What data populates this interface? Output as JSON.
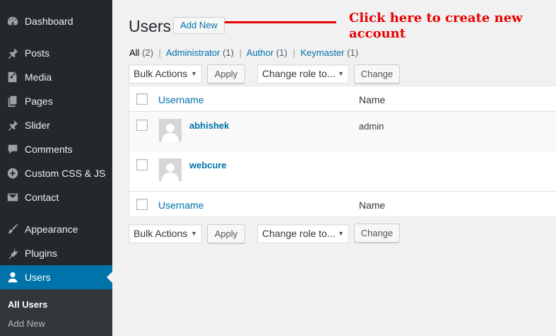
{
  "sidebar": {
    "items": [
      {
        "label": "Dashboard",
        "icon": "dashboard-icon"
      },
      {
        "label": "Posts",
        "icon": "pin-icon"
      },
      {
        "label": "Media",
        "icon": "media-icon"
      },
      {
        "label": "Pages",
        "icon": "pages-icon"
      },
      {
        "label": "Slider",
        "icon": "pin-icon"
      },
      {
        "label": "Comments",
        "icon": "comment-icon"
      },
      {
        "label": "Custom CSS & JS",
        "icon": "plus-circle-icon"
      },
      {
        "label": "Contact",
        "icon": "mail-icon"
      },
      {
        "label": "Appearance",
        "icon": "brush-icon"
      },
      {
        "label": "Plugins",
        "icon": "plugin-icon"
      },
      {
        "label": "Users",
        "icon": "user-icon",
        "active": true
      }
    ],
    "submenu": [
      {
        "label": "All Users"
      },
      {
        "label": "Add New"
      }
    ]
  },
  "header": {
    "title": "Users",
    "add_new": "Add New"
  },
  "annotation": {
    "line1": "Click here to create new",
    "line2": "account"
  },
  "filters": {
    "all": "All",
    "all_count": "(2)",
    "administrator": "Administrator",
    "administrator_count": "(1)",
    "author": "Author",
    "author_count": "(1)",
    "keymaster": "Keymaster",
    "keymaster_count": "(1)",
    "sep": "|"
  },
  "actions": {
    "bulk": "Bulk Actions",
    "apply": "Apply",
    "change_role": "Change role to...",
    "change": "Change"
  },
  "table": {
    "col_username": "Username",
    "col_name": "Name",
    "rows": [
      {
        "username": "abhishek",
        "name": "admin"
      },
      {
        "username": "webcure",
        "name": ""
      }
    ]
  },
  "colors": {
    "sidebar_bg": "#23282d",
    "active_bg": "#0073aa",
    "link": "#0073aa",
    "annotation": "#e60000"
  }
}
